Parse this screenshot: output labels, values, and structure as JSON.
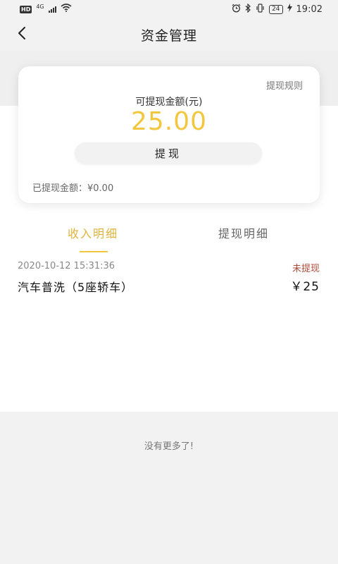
{
  "status_bar": {
    "hd": "HD",
    "network": "4G",
    "battery": "24",
    "time": "19:02"
  },
  "header": {
    "title": "资金管理",
    "back_icon": "chevron-left-icon"
  },
  "card": {
    "rules_link": "提现规则",
    "available_label": "可提现金额(元)",
    "available_amount": "25.00",
    "withdraw_button": "提现",
    "withdrawn_text": "已提现金额：¥0.00"
  },
  "tabs": [
    {
      "label": "收入明细",
      "active": true
    },
    {
      "label": "提现明细",
      "active": false
    }
  ],
  "records": [
    {
      "time": "2020-10-12 15:31:36",
      "title": "汽车普洗（5座轿车）",
      "status": "未提现",
      "amount": "￥25"
    }
  ],
  "footer": {
    "no_more": "没有更多了!"
  },
  "colors": {
    "accent": "#f2c73e",
    "status_pending": "#b04a3a",
    "page_bg": "#f2f2f2"
  }
}
